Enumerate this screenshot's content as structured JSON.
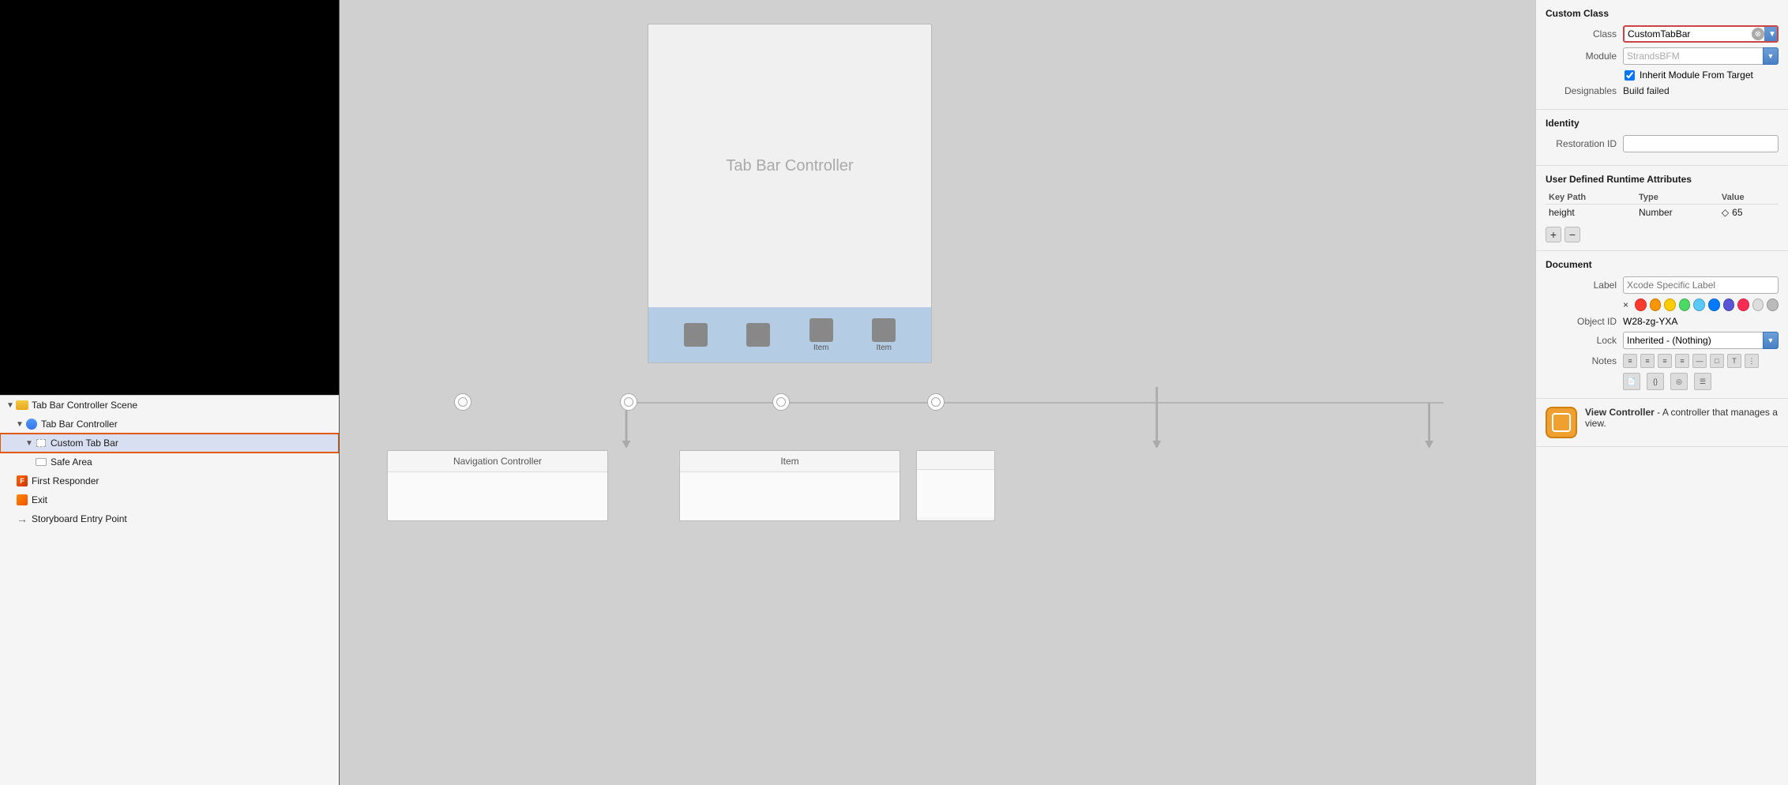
{
  "leftPanel": {
    "canvasPreview": "black",
    "sceneItems": [
      {
        "id": "scene-header",
        "label": "Tab Bar Controller Scene",
        "indent": 0,
        "icon": "folder",
        "expanded": true,
        "hasTriangle": true
      },
      {
        "id": "tab-bar-controller",
        "label": "Tab Bar Controller",
        "indent": 1,
        "icon": "blue-circle",
        "expanded": true,
        "hasTriangle": true
      },
      {
        "id": "custom-tab-bar",
        "label": "Custom Tab Bar",
        "indent": 2,
        "icon": "dotted-rect",
        "expanded": true,
        "hasTriangle": true,
        "selected": true,
        "highlighted": true
      },
      {
        "id": "safe-area",
        "label": "Safe Area",
        "indent": 3,
        "icon": "white-rect"
      },
      {
        "id": "first-responder",
        "label": "First Responder",
        "indent": 1,
        "icon": "orange-square"
      },
      {
        "id": "exit",
        "label": "Exit",
        "indent": 1,
        "icon": "orange-rect"
      },
      {
        "id": "storyboard-entry-point",
        "label": "Storyboard Entry Point",
        "indent": 1,
        "icon": "arrow"
      }
    ]
  },
  "canvas": {
    "tabBarController": {
      "label": "Tab Bar Controller",
      "tabBarItems": [
        "",
        "",
        "Item",
        "Item"
      ]
    },
    "arrowLabel": "",
    "subControllers": [
      {
        "label": "Navigation Controller"
      },
      {
        "label": "Item"
      }
    ]
  },
  "rightPanel": {
    "sections": {
      "customClass": {
        "header": "Custom Class",
        "classLabel": "Class",
        "classValue": "CustomTabBar",
        "moduleLabel": "Module",
        "moduleValue": "StrandsBFM",
        "inheritCheckbox": "Inherit Module From Target",
        "designablesLabel": "Designables",
        "designablesValue": "Build failed"
      },
      "identity": {
        "header": "Identity",
        "restorationIdLabel": "Restoration ID",
        "restorationIdValue": ""
      },
      "userDefinedRuntime": {
        "header": "User Defined Runtime Attributes",
        "columns": [
          "Key Path",
          "Type",
          "Value"
        ],
        "rows": [
          {
            "keyPath": "height",
            "type": "Number",
            "value": "◇ 65"
          }
        ]
      },
      "document": {
        "header": "Document",
        "labelLabel": "Label",
        "labelPlaceholder": "Xcode Specific Label",
        "xButton": "×",
        "colors": [
          "#ff3b30",
          "#ff9500",
          "#ffcc00",
          "#4cd964",
          "#5ac8fa",
          "#007aff",
          "#5856d6",
          "#ff2d55",
          "#ddd",
          "#bbb"
        ],
        "objectIdLabel": "Object ID",
        "objectIdValue": "W28-zg-YXA",
        "lockLabel": "Lock",
        "lockValue": "Inherited - (Nothing)",
        "notesLabel": "Notes"
      },
      "viewController": {
        "title": "View Controller",
        "description": "A controller that manages a view."
      }
    }
  }
}
